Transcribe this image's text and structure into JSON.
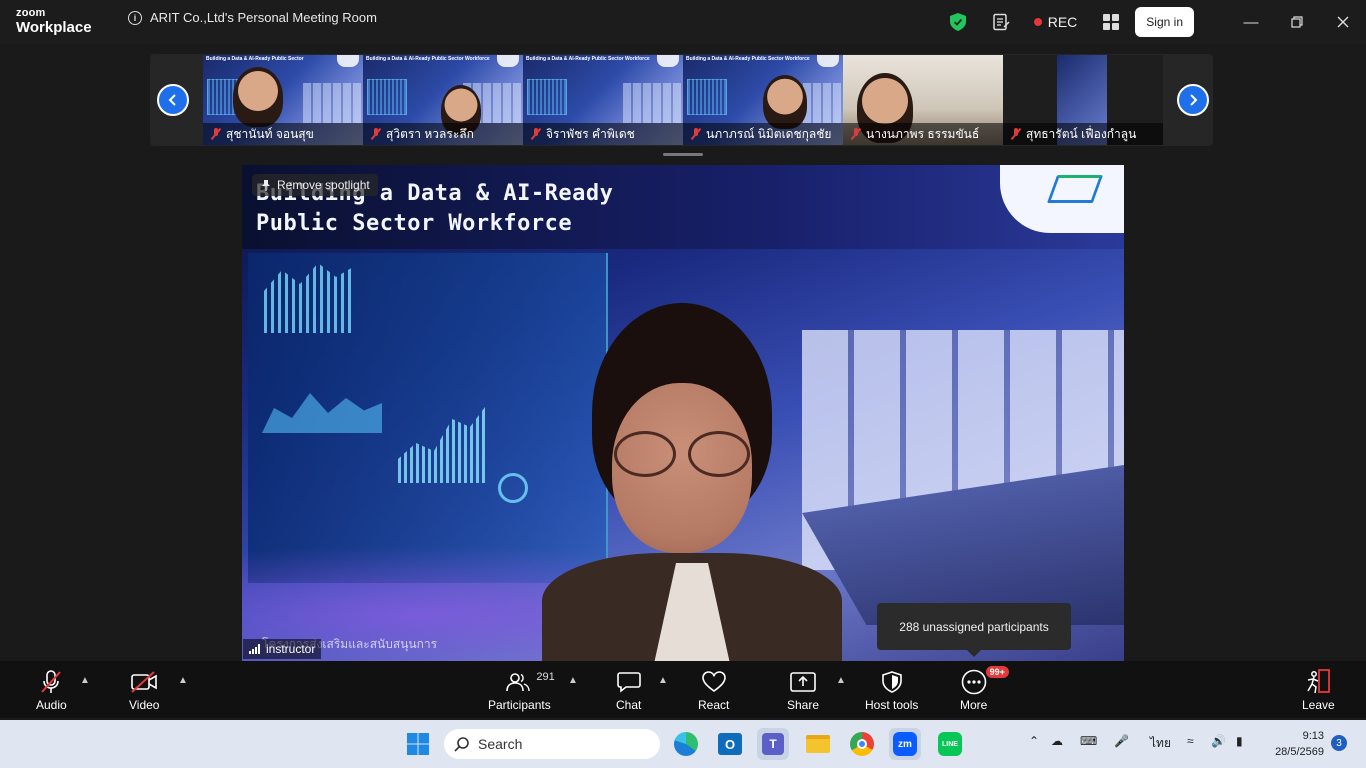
{
  "app": {
    "logo_line1": "zoom",
    "logo_line2": "Workplace",
    "meeting_title": "ARIT Co.,Ltd's Personal Meeting Room",
    "rec_label": "REC",
    "sign_in_label": "Sign in"
  },
  "thumbnails": [
    {
      "name": "สุชานันท์ จอนสุข",
      "slide_text": "Building a Data & AI-Ready Public Sector",
      "muted": true
    },
    {
      "name": "สุวิตรา หวลระลึก",
      "slide_text": "Building a Data & AI-Ready Public Sector Workforce",
      "muted": true
    },
    {
      "name": "จิราพัชร คำพิเดช",
      "slide_text": "Building a Data & AI-Ready Public Sector Workforce",
      "muted": true
    },
    {
      "name": "นภาภรณ์ นิมิตเดชกุลชัย",
      "slide_text": "Building a Data & AI-Ready Public Sector Workforce",
      "muted": true
    },
    {
      "name": "นางนภาพร ธรรมขันธ์",
      "slide_text": "",
      "muted": true
    },
    {
      "name": "สุทธารัตน์ เฟื่องกำลูน",
      "slide_text": "",
      "muted": true
    }
  ],
  "main_video": {
    "slide_title_line1": "Building a Data & AI-Ready",
    "slide_title_line2": "Public Sector Workforce",
    "bottom_caption": "โครงการส่งเสริมและสนับสนุนการ",
    "spotlight_label": "Remove spotlight",
    "participant_name": "instructor"
  },
  "tooltip": {
    "text": "288 unassigned participants"
  },
  "toolbar": {
    "audio_label": "Audio",
    "video_label": "Video",
    "participants_label": "Participants",
    "participants_count": "291",
    "chat_label": "Chat",
    "react_label": "React",
    "share_label": "Share",
    "host_tools_label": "Host tools",
    "more_label": "More",
    "more_badge": "99+",
    "leave_label": "Leave"
  },
  "taskbar": {
    "search_placeholder": "Search",
    "language": "ไทย",
    "time": "9:13",
    "date": "28/5/2569",
    "notification_count": "3",
    "zoom_app_label": "zm",
    "line_app_label": "LINE"
  },
  "colors": {
    "accent_blue": "#1f6fea",
    "rec_red": "#e5383b",
    "shield_green": "#22c55e"
  }
}
